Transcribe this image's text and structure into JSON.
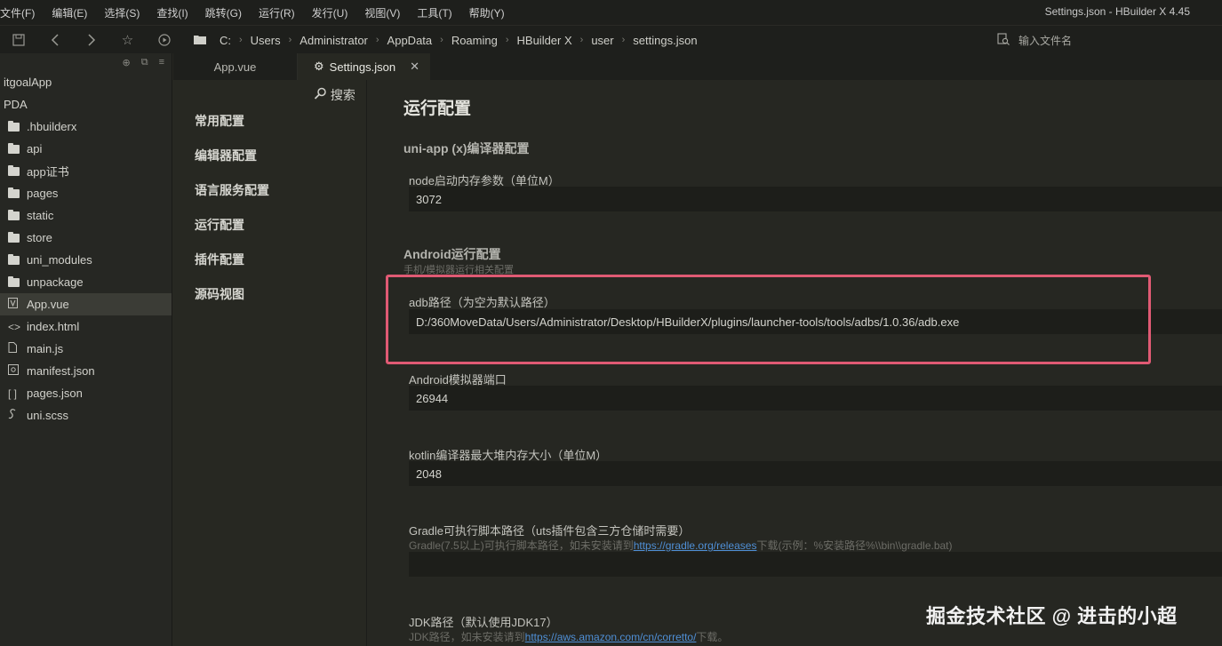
{
  "menu": [
    "文件(F)",
    "编辑(E)",
    "选择(S)",
    "查找(I)",
    "跳转(G)",
    "运行(R)",
    "发行(U)",
    "视图(V)",
    "工具(T)",
    "帮助(Y)"
  ],
  "window_title": "Settings.json - HBuilder X 4.45",
  "breadcrumb": [
    "C:",
    "Users",
    "Administrator",
    "AppData",
    "Roaming",
    "HBuilder X",
    "user",
    "settings.json"
  ],
  "file_search_placeholder": "输入文件名",
  "explorer": {
    "roots": [
      "itgoalApp",
      "PDA"
    ],
    "items": [
      {
        "label": ".hbuilderx",
        "type": "folder"
      },
      {
        "label": "api",
        "type": "folder"
      },
      {
        "label": "app证书",
        "type": "folder"
      },
      {
        "label": "pages",
        "type": "folder"
      },
      {
        "label": "static",
        "type": "folder"
      },
      {
        "label": "store",
        "type": "folder"
      },
      {
        "label": "uni_modules",
        "type": "folder"
      },
      {
        "label": "unpackage",
        "type": "folder"
      },
      {
        "label": "App.vue",
        "type": "vue",
        "selected": true
      },
      {
        "label": "index.html",
        "type": "html"
      },
      {
        "label": "main.js",
        "type": "js"
      },
      {
        "label": "manifest.json",
        "type": "manifest"
      },
      {
        "label": "pages.json",
        "type": "json"
      },
      {
        "label": "uni.scss",
        "type": "scss"
      }
    ]
  },
  "tabs": [
    {
      "label": "App.vue",
      "active": false
    },
    {
      "label": "Settings.json",
      "active": true
    }
  ],
  "settings_nav": {
    "search_label": "搜索",
    "items": [
      "常用配置",
      "编辑器配置",
      "语言服务配置",
      "运行配置",
      "插件配置",
      "源码视图"
    ]
  },
  "content": {
    "title": "运行配置",
    "section1": "uni-app (x)编译器配置",
    "node_label": "node启动内存参数（单位M）",
    "node_value": "3072",
    "section2": "Android运行配置",
    "section2_desc": "手机/模拟器运行相关配置",
    "adb_label": "adb路径（为空为默认路径）",
    "adb_value": "D:/360MoveData/Users/Administrator/Desktop/HBuilderX/plugins/launcher-tools/tools/adbs/1.0.36/adb.exe",
    "emu_label": "Android模拟器端口",
    "emu_value": "26944",
    "kotlin_label": "kotlin编译器最大堆内存大小（单位M）",
    "kotlin_value": "2048",
    "gradle_label": "Gradle可执行脚本路径（uts插件包含三方仓储时需要）",
    "gradle_desc_prefix": "Gradle(7.5以上)可执行脚本路径，如未安装请到",
    "gradle_link": "https://gradle.org/releases",
    "gradle_desc_suffix": "下载(示例：%安装路径%\\\\bin\\\\gradle.bat)",
    "gradle_value": "",
    "jdk_label": "JDK路径（默认使用JDK17）",
    "jdk_desc_prefix": "JDK路径，如未安装请到",
    "jdk_link": "https://aws.amazon.com/cn/corretto/",
    "jdk_desc_suffix": "下载。"
  },
  "watermark": "掘金技术社区 @ 进击的小超",
  "colors": {
    "highlight": "#e05a74",
    "link": "#4f8fd6",
    "background": "#272822"
  }
}
